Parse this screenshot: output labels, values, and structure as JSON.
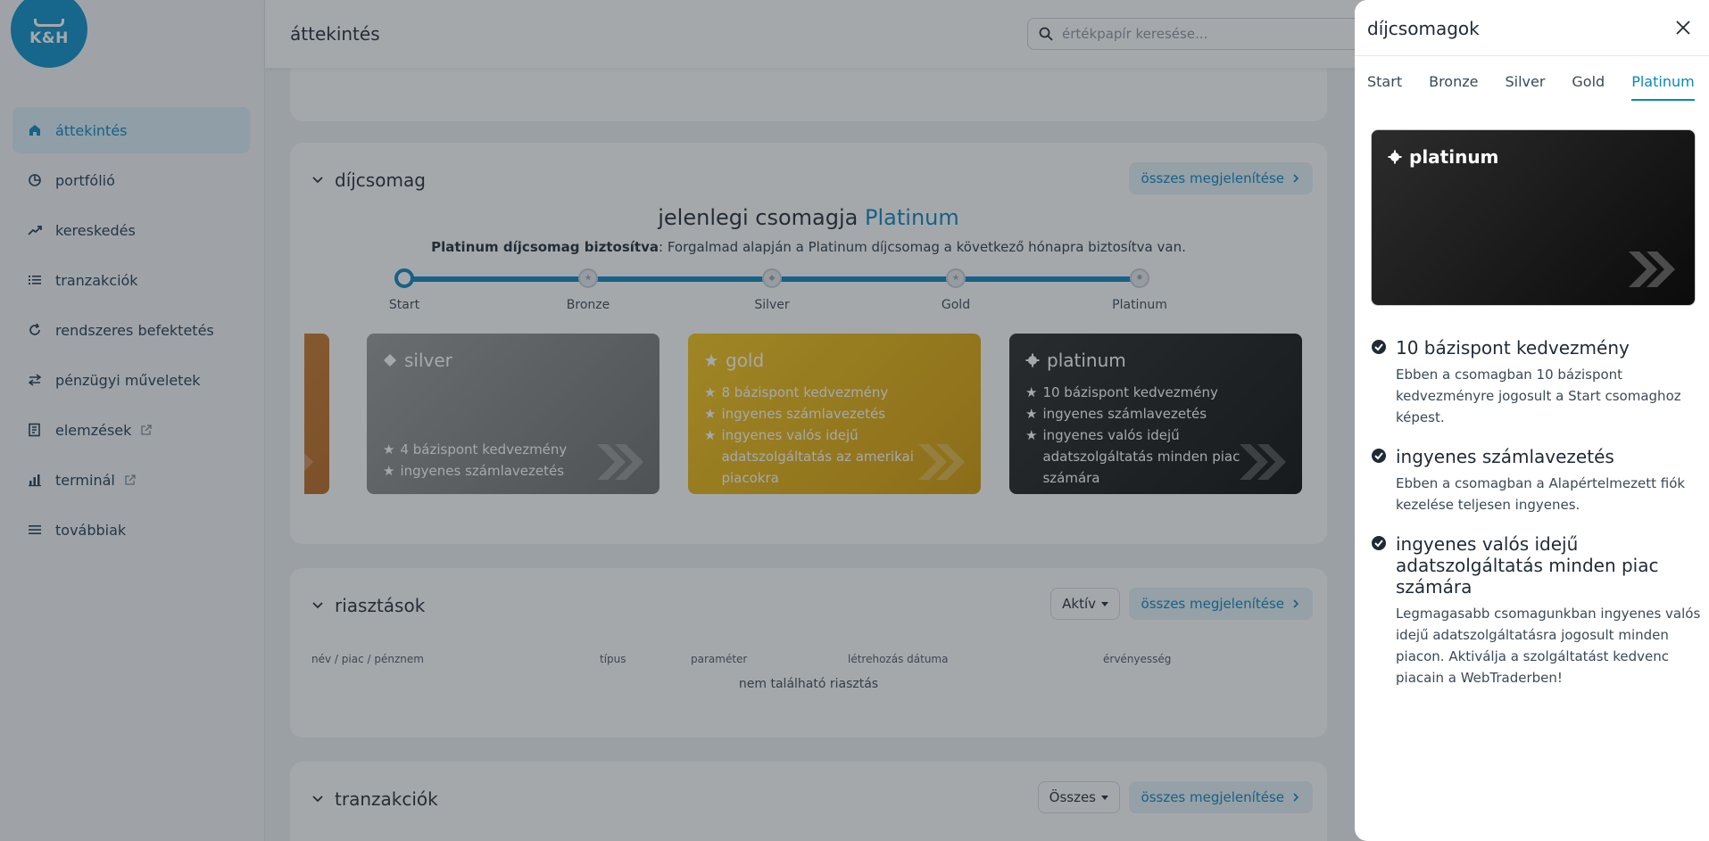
{
  "app": {
    "logo_text": "K&H",
    "page_title": "áttekintés"
  },
  "search": {
    "placeholder": "értékpapír keresése..."
  },
  "sidebar": {
    "items": [
      {
        "label": "áttekintés",
        "icon": "home-icon",
        "active": true
      },
      {
        "label": "portfólió",
        "icon": "pie-chart-icon"
      },
      {
        "label": "kereskedés",
        "icon": "trend-up-icon"
      },
      {
        "label": "tranzakciók",
        "icon": "list-icon"
      },
      {
        "label": "rendszeres befektetés",
        "icon": "refresh-icon"
      },
      {
        "label": "pénzügyi műveletek",
        "icon": "transfer-icon"
      },
      {
        "label": "elemzések",
        "icon": "document-icon",
        "external": true
      },
      {
        "label": "terminál",
        "icon": "bar-chart-icon",
        "external": true
      },
      {
        "label": "továbbiak",
        "icon": "menu-icon"
      }
    ]
  },
  "fee_section": {
    "title": "díjcsomag",
    "show_all": "összes megjelenítése",
    "current_prefix": "jelenlegi csomagja",
    "current_name": "Platinum",
    "guarantee_bold": "Platinum díjcsomag biztosítva",
    "guarantee_text": ": Forgalmad alapján a Platinum díjcsomag a következő hónapra biztosítva van.",
    "steps": [
      "Start",
      "Bronze",
      "Silver",
      "Gold",
      "Platinum"
    ],
    "tiers": {
      "silver": {
        "name": "silver",
        "features": [
          "4 bázispont kedvezmény",
          "ingyenes számlavezetés"
        ]
      },
      "gold": {
        "name": "gold",
        "features": [
          "8 bázispont kedvezmény",
          "ingyenes számlavezetés",
          "ingyenes valós idejű adatszolgáltatás az amerikai piacokra"
        ]
      },
      "platinum": {
        "name": "platinum",
        "features": [
          "10 bázispont kedvezmény",
          "ingyenes számlavezetés",
          "ingyenes valós idejű adatszolgáltatás minden piac számára"
        ]
      }
    }
  },
  "alerts_section": {
    "title": "riasztások",
    "filter": "Aktív",
    "show_all": "összes megjelenítése",
    "columns": [
      "név / piac / pénznem",
      "típus",
      "paraméter",
      "létrehozás dátuma",
      "érvényesség"
    ],
    "empty": "nem található riasztás"
  },
  "trx_section": {
    "title": "tranzakciók",
    "filter": "Összes",
    "show_all": "összes megjelenítése"
  },
  "panel": {
    "title": "díjcsomagok",
    "tabs": [
      "Start",
      "Bronze",
      "Silver",
      "Gold",
      "Platinum"
    ],
    "active_tab": "Platinum",
    "card_name": "platinum",
    "benefits": [
      {
        "title": "10 bázispont kedvezmény",
        "desc": "Ebben a csomagban 10 bázispont kedvezményre jogosult a Start csomaghoz képest."
      },
      {
        "title": "ingyenes számlavezetés",
        "desc": "Ebben a csomagban a Alapértelmezett fiók kezelése teljesen ingyenes."
      },
      {
        "title": "ingyenes valós idejű adatszolgáltatás minden piac számára",
        "desc": "Legmagasabb csomagunkban ingyenes valós idejű adatszolgáltatásra jogosult minden piacon. Aktiválja a szolgáltatást kedvenc piacain a WebTraderben!"
      }
    ]
  },
  "colors": {
    "accent": "#0a86bf",
    "brand": "#0a8fc9",
    "gold": "#f5c518",
    "platinum": "#111111"
  }
}
